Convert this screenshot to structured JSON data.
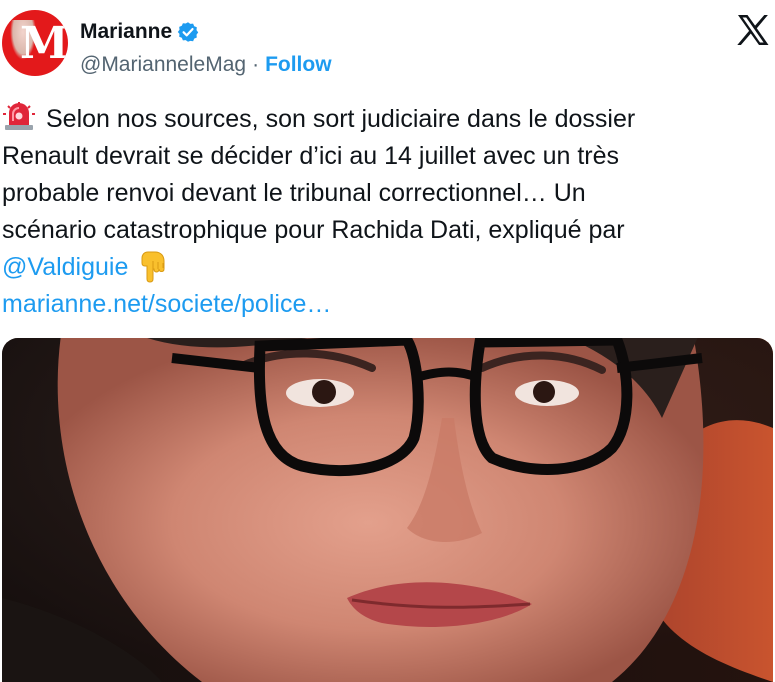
{
  "account": {
    "display_name": "Marianne",
    "handle": "@MarianneleMag",
    "separator": "·",
    "follow_label": "Follow",
    "verified": true,
    "brand_color": "#e3191b",
    "avatar_letter": "M"
  },
  "platform": {
    "logo_icon": "x-logo-icon"
  },
  "tweet": {
    "line1": "Selon nos sources, son sort judiciaire dans le dossier",
    "line2": "Renault devrait se décider d’ici au 14 juillet avec un très",
    "line3": "probable renvoi devant le tribunal correctionnel… Un",
    "line4": "scénario catastrophique pour Rachida Dati, expliqué par",
    "mention": "@Valdiguie",
    "leading_emoji_icon": "rotating-light-icon",
    "trailing_emoji_icon": "backhand-index-pointing-down-icon",
    "link": "marianne.net/societe/police…"
  },
  "media": {
    "type": "photo"
  },
  "colors": {
    "link": "#1d9bf0",
    "text": "#0f1419",
    "secondary": "#536471"
  }
}
